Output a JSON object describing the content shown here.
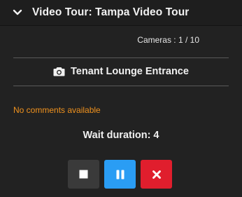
{
  "header": {
    "title": "Video Tour: Tampa Video Tour",
    "toggle_icon": "chevron-down-icon"
  },
  "cameras": {
    "label": "Cameras : 1 / 10"
  },
  "camera": {
    "icon": "camera-icon",
    "name": "Tenant Lounge Entrance"
  },
  "comments": {
    "text": "No comments available",
    "color": "#f0921e"
  },
  "wait": {
    "label": "Wait duration: 4"
  },
  "controls": {
    "stop": {
      "icon": "stop-icon",
      "color": "#3a3a3a"
    },
    "pause": {
      "icon": "pause-icon",
      "color": "#2a9df4"
    },
    "close": {
      "icon": "close-icon",
      "color": "#e01e2d"
    }
  }
}
